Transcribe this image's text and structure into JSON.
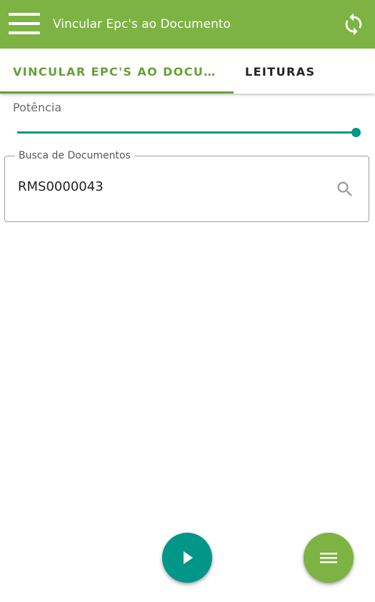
{
  "appbar": {
    "title": "Vincular Epc's ao Documento",
    "icons": {
      "menu": "menu-icon",
      "sync": "sync-icon"
    },
    "background": "#7cb342"
  },
  "tabs": [
    {
      "label": "VINCULAR EPC'S AO DOCUMENTO",
      "selected": true
    },
    {
      "label": "LEITURAS",
      "selected": false
    }
  ],
  "potencia": {
    "label": "Potência",
    "level_fraction": 1.0,
    "color": "#009688"
  },
  "search": {
    "label": "Busca de Documentos",
    "value": "RMS0000043",
    "icon": "search-icon"
  },
  "fabs": {
    "play_icon": "play-icon",
    "play_color": "#009688",
    "menu_icon": "list-icon",
    "menu_color": "#7cb342"
  },
  "colors": {
    "accent": "#689f38",
    "teal": "#009688"
  }
}
